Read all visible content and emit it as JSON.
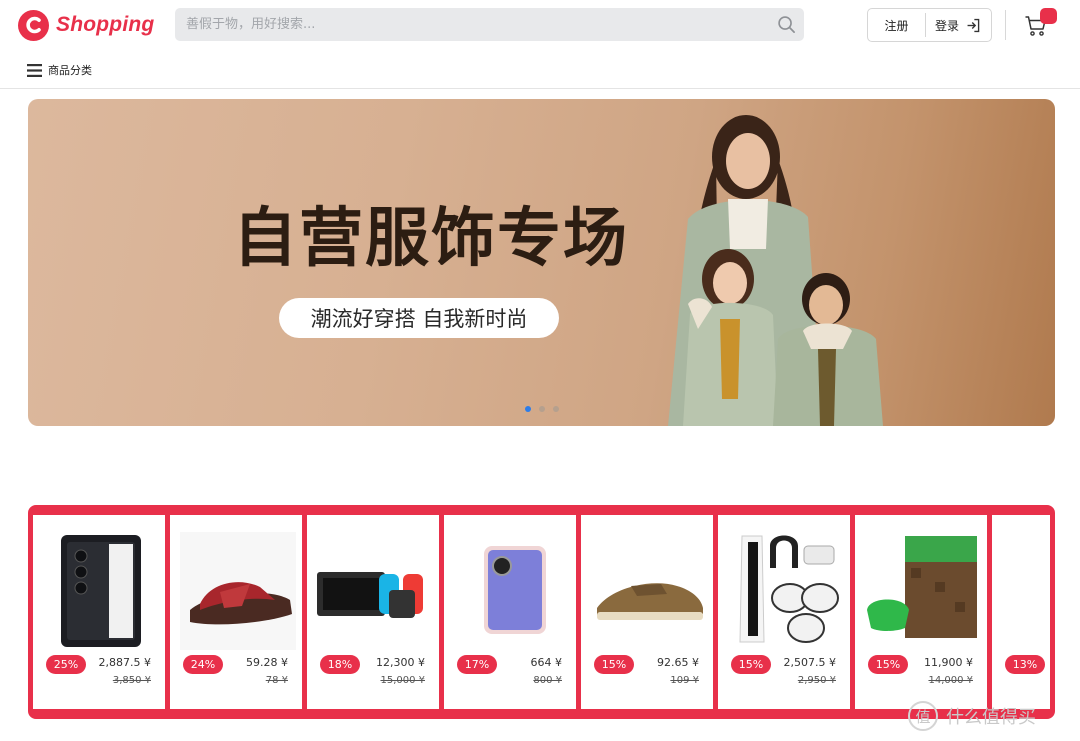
{
  "header": {
    "logo_text": "Shopping",
    "logo_letter": "C",
    "search_placeholder": "善假于物，用好搜索...",
    "register_label": "注册",
    "login_label": "登录",
    "cart_icon": "cart-icon"
  },
  "subnav": {
    "menu_label": "商品分类"
  },
  "banner": {
    "title": "自营服饰专场",
    "subtitle": "潮流好穿搭  自我新时尚",
    "slide_count": 3,
    "active_slide": 1
  },
  "deals": [
    {
      "discount": "25%",
      "price": "2,887.5 ¥",
      "old_price": "3,850 ¥",
      "product": "phone"
    },
    {
      "discount": "24%",
      "price": "59.28 ¥",
      "old_price": "78 ¥",
      "product": "sandal"
    },
    {
      "discount": "18%",
      "price": "12,300 ¥",
      "old_price": "15,000 ¥",
      "product": "game-console"
    },
    {
      "discount": "17%",
      "price": "664 ¥",
      "old_price": "800 ¥",
      "product": "phone"
    },
    {
      "discount": "15%",
      "price": "92.65 ¥",
      "old_price": "109 ¥",
      "product": "shoe"
    },
    {
      "discount": "15%",
      "price": "2,507.5 ¥",
      "old_price": "2,950 ¥",
      "product": "console-bundle"
    },
    {
      "discount": "15%",
      "price": "11,900 ¥",
      "old_price": "14,000 ¥",
      "product": "xbox"
    },
    {
      "discount": "13%",
      "price": "",
      "old_price": "",
      "product": "phone"
    }
  ],
  "watermark": {
    "text": "什么值得买",
    "icon": "值"
  },
  "colors": {
    "brand": "#e8304a",
    "search_bg": "#e8e9eb",
    "active_dot": "#2d7de8"
  }
}
